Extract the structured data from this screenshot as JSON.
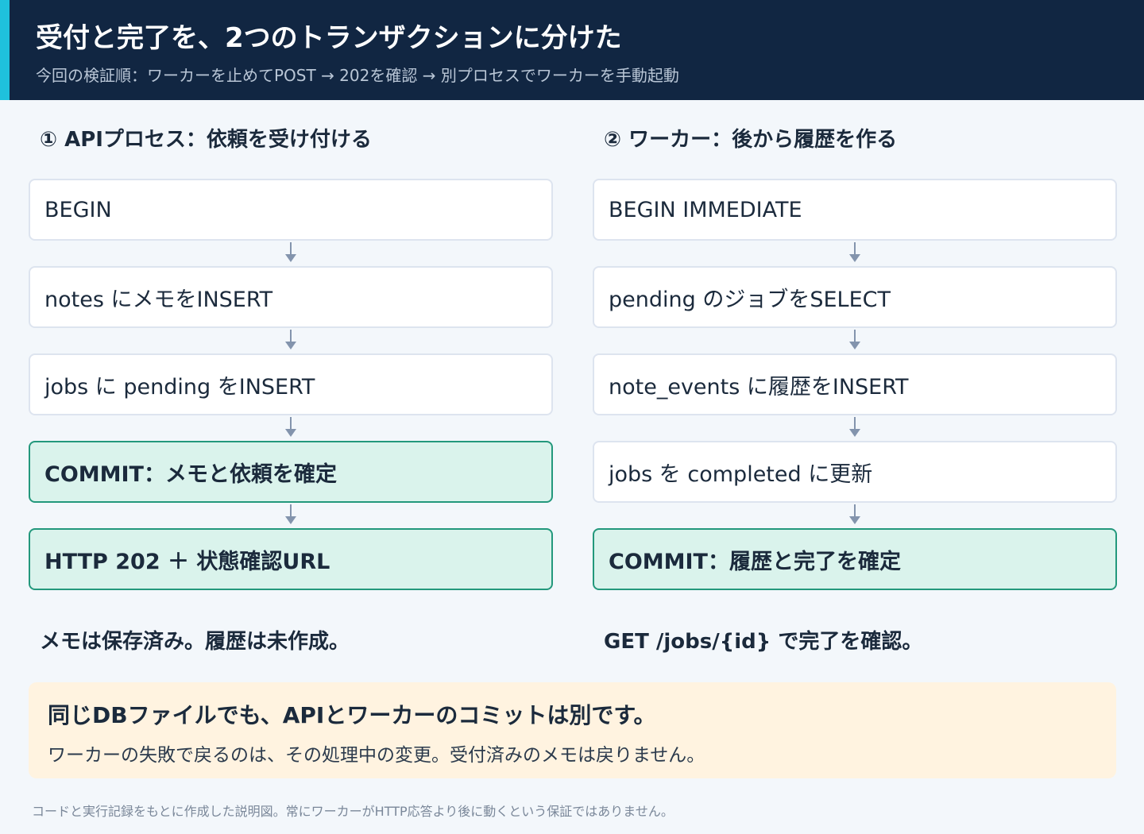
{
  "header": {
    "title": "受付と完了を、2つのトランザクションに分けた",
    "subtitle": "今回の検証順：ワーカーを止めてPOST → 202を確認 → 別プロセスでワーカーを手動起動"
  },
  "api": {
    "title": "① APIプロセス：依頼を受け付ける",
    "steps": [
      "BEGIN",
      "notes にメモをINSERT",
      "jobs に pending をINSERT",
      "COMMIT：メモと依頼を確定",
      "HTTP 202 ＋ 状態確認URL"
    ],
    "summary": "メモは保存済み。履歴は未作成。"
  },
  "worker": {
    "title": "② ワーカー：後から履歴を作る",
    "steps": [
      "BEGIN IMMEDIATE",
      "pending のジョブをSELECT",
      "note_events に履歴をINSERT",
      "jobs を completed に更新",
      "COMMIT：履歴と完了を確定"
    ],
    "summary": "GET /jobs/{id} で完了を確認。"
  },
  "note": {
    "heading": "同じDBファイルでも、APIとワーカーのコミットは別です。",
    "body": "ワーカーの失敗で戻るのは、その処理中の変更。受付済みのメモは戻りません。"
  },
  "footer": "コードと実行記録をもとに作成した説明図。常にワーカーがHTTP応答より後に動くという保証ではありません。",
  "colors": {
    "header_bg": "#112642",
    "accent": "#1fc1dc",
    "commit_bg": "#daf3ec",
    "commit_border": "#23987c",
    "note_bg": "#fff3e0"
  }
}
